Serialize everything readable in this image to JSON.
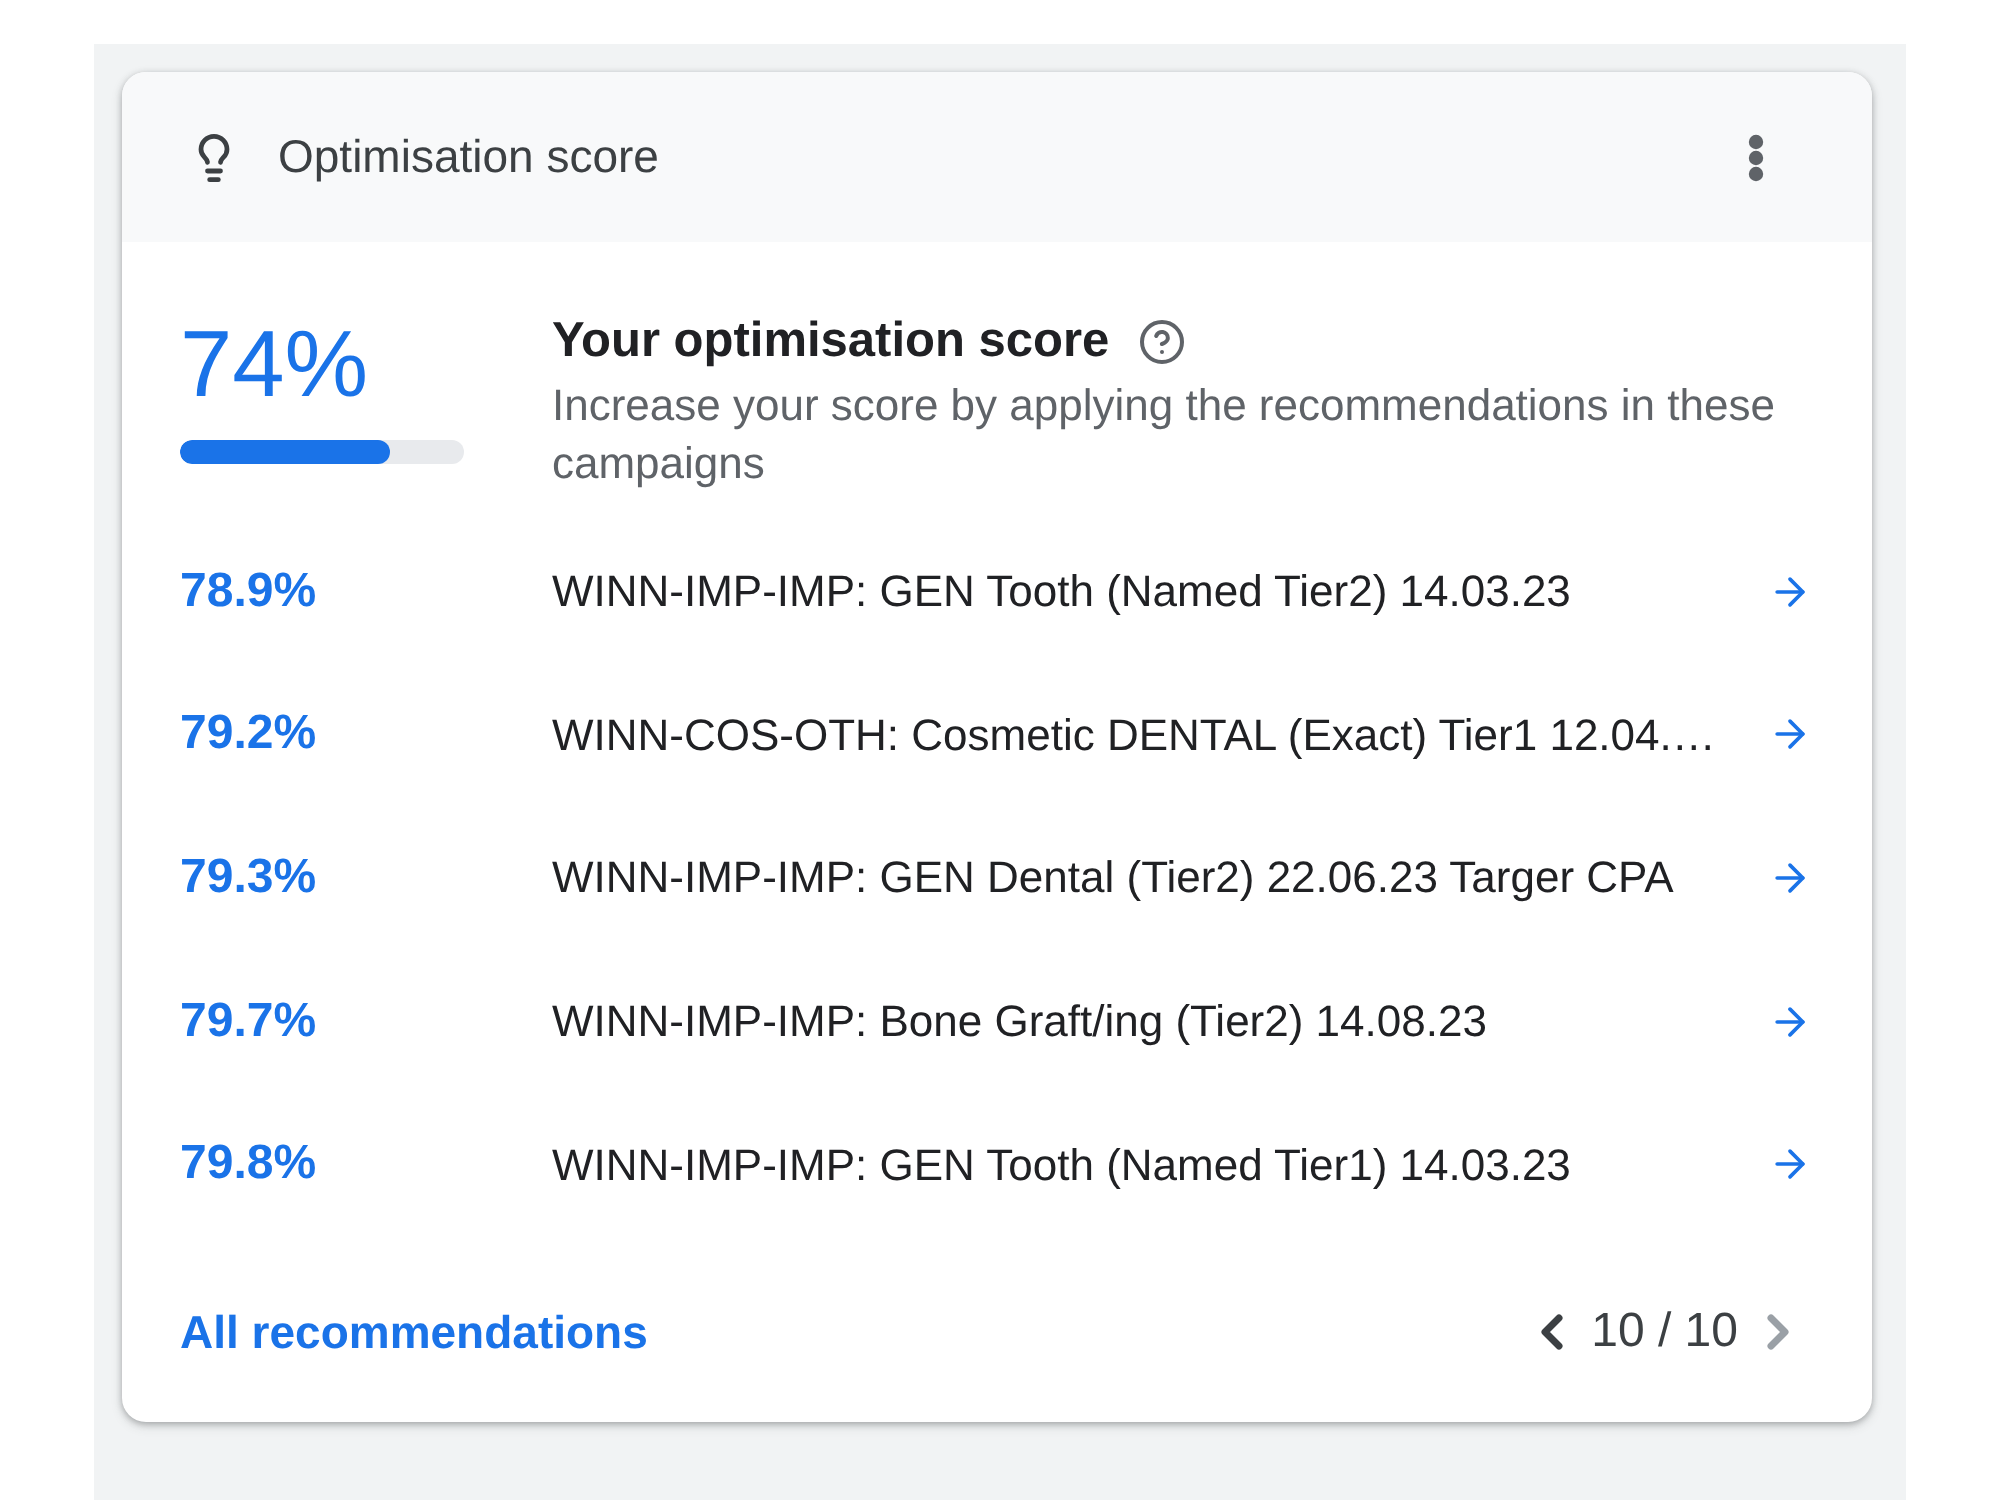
{
  "card": {
    "title": "Optimisation score"
  },
  "score": {
    "value": "74%",
    "level": 0.74,
    "title": "Your optimisation score",
    "description": "Increase your score by applying the recommendations in these campaigns"
  },
  "campaigns": [
    {
      "score": "78.9%",
      "name": "WINN-IMP-IMP: GEN Tooth (Named Tier2) 14.03.23"
    },
    {
      "score": "79.2%",
      "name": "WINN-COS-OTH: Cosmetic DENTAL (Exact) Tier1 12.04.…"
    },
    {
      "score": "79.3%",
      "name": "WINN-IMP-IMP: GEN Dental (Tier2) 22.06.23 Targer CPA"
    },
    {
      "score": "79.7%",
      "name": "WINN-IMP-IMP: Bone Graft/ing (Tier2) 14.08.23"
    },
    {
      "score": "79.8%",
      "name": "WINN-IMP-IMP: GEN Tooth (Named Tier1) 14.03.23"
    }
  ],
  "footer": {
    "link": "All recommendations",
    "pagination": {
      "label": "10 / 10",
      "previous": {
        "disabled": false
      },
      "next": {
        "disabled": true
      }
    }
  }
}
